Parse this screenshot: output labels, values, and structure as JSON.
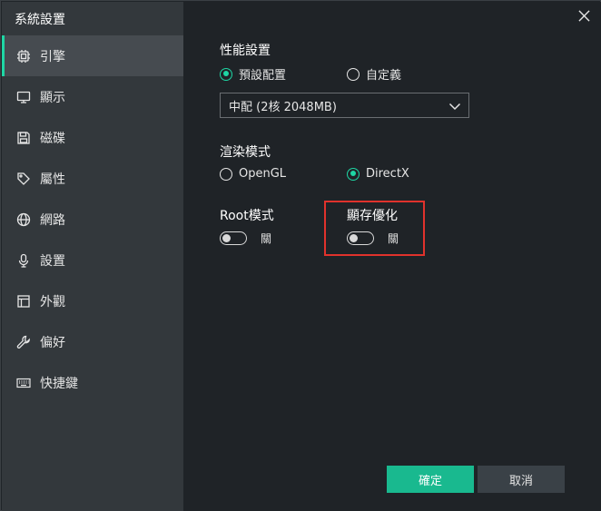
{
  "window": {
    "title": "系統設置"
  },
  "sidebar": {
    "items": [
      {
        "label": "引擎",
        "icon": "chip-icon",
        "active": true
      },
      {
        "label": "顯示",
        "icon": "monitor-icon",
        "active": false
      },
      {
        "label": "磁碟",
        "icon": "disk-icon",
        "active": false
      },
      {
        "label": "屬性",
        "icon": "tag-icon",
        "active": false
      },
      {
        "label": "網路",
        "icon": "globe-icon",
        "active": false
      },
      {
        "label": "設置",
        "icon": "microphone-icon",
        "active": false
      },
      {
        "label": "外觀",
        "icon": "window-icon",
        "active": false
      },
      {
        "label": "偏好",
        "icon": "wrench-icon",
        "active": false
      },
      {
        "label": "快捷鍵",
        "icon": "keyboard-icon",
        "active": false
      }
    ]
  },
  "performance": {
    "title": "性能設置",
    "option_preset": "預設配置",
    "option_custom": "自定義",
    "selected": "preset",
    "select_value": "中配 (2核 2048MB)"
  },
  "render": {
    "title": "渲染模式",
    "option_opengl": "OpenGL",
    "option_directx": "DirectX",
    "selected": "directx"
  },
  "root": {
    "title": "Root模式",
    "state_label": "關"
  },
  "cache": {
    "title": "顯存優化",
    "state_label": "關"
  },
  "buttons": {
    "ok": "確定",
    "cancel": "取消"
  },
  "colors": {
    "accent": "#1ed6a4",
    "ok_button": "#19b98f",
    "highlight": "#e0322c"
  }
}
